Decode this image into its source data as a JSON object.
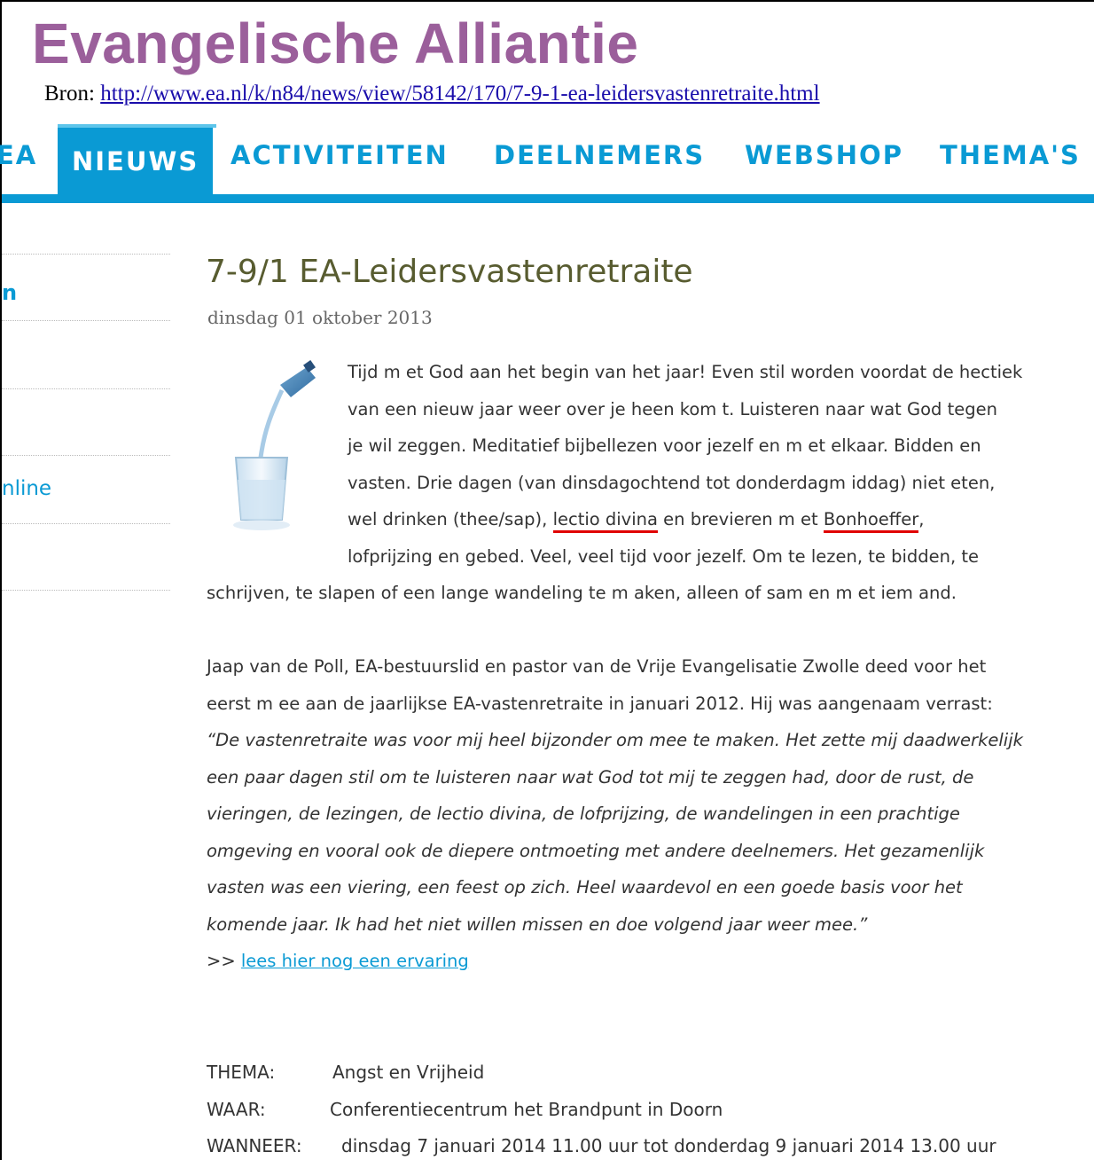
{
  "header": {
    "site_title": "Evangelische Alliantie",
    "source_label": "Bron:",
    "source_url": "http://www.ea.nl/k/n84/news/view/58142/170/7-9-1-ea-leidersvastenretraite.html"
  },
  "nav": {
    "items": [
      {
        "label": "EA",
        "active": false
      },
      {
        "label": "NIEUWS",
        "active": true
      },
      {
        "label": "ACTIVITEITEN",
        "active": false
      },
      {
        "label": "DEELNEMERS",
        "active": false
      },
      {
        "label": "WEBSHOP",
        "active": false
      },
      {
        "label": "THEMA'S",
        "active": false
      }
    ],
    "accent_color": "#0a9ad4"
  },
  "sidebar": {
    "items": [
      {
        "label": "n"
      },
      {
        "label": ""
      },
      {
        "label": ""
      },
      {
        "label": "nline"
      },
      {
        "label": ""
      }
    ]
  },
  "article": {
    "title": "7-9/1 EA-Leidersvastenretraite",
    "date": "dinsdag 01 oktober 2013",
    "image_icon": "water-glass-image",
    "intro_lines": [
      "Tijd m et God aan het begin van het jaar! Even stil worden voordat de hectiek",
      "van een nieuw jaar weer over je heen kom t. Luisteren naar wat God tegen",
      "je wil zeggen. Meditatief bijbellezen voor jezelf en m et elkaar. Bidden en",
      "vasten. Drie dagen (van dinsdagochtend tot donderdagm iddag) niet eten,",
      "lofprijzing en gebed. Veel, veel tijd voor jezelf. Om  te lezen, te bidden, te"
    ],
    "intro_line5": {
      "before": "wel drinken (thee/sap), ",
      "mark1": "lectio divina",
      "middle": " en brevieren m et ",
      "mark2": "Bonhoeffer",
      "after": ","
    },
    "intro_last": "schrijven, te slapen of een lange wandeling te m aken, alleen of sam en m et iem and.",
    "testimony_lines": [
      "Jaap van de Poll, EA-bestuurslid en pastor van de Vrije Evangelisatie Zwolle deed voor het",
      "eerst m ee aan de jaarlijkse EA-vastenretraite in januari 2012. Hij was aangenaam  verrast:"
    ],
    "quote_lines": [
      "“De vastenretraite was voor mij heel bijzonder om mee te maken. Het zette mij daadwerkelijk",
      "een paar dagen stil om te luisteren naar wat God tot mij te zeggen had, door de rust, de",
      "vieringen, de lezingen, de lectio divina, de lofprijzing, de wandelingen in een prachtige",
      "omgeving en vooral ook de diepere ontmoeting met andere deelnemers. Het gezamenlijk",
      "vasten was een viering, een feest op zich. Heel waardevol en een goede basis voor het",
      "komende jaar. Ik had het niet willen missen en doe volgend jaar weer mee.”"
    ],
    "more_prefix": ">> ",
    "more_link": "lees hier nog een ervaring",
    "info": [
      {
        "label": "THEMA:",
        "value": "Angst en Vrijheid"
      },
      {
        "label": "WAAR:",
        "value": "Conferentiecentrum  het Brandpunt in Doorn"
      },
      {
        "label": "WANNEER:",
        "value": "dinsdag 7 januari 2014 11.00 uur tot donderdag 9 januari 2014 13.00 uur"
      }
    ]
  }
}
